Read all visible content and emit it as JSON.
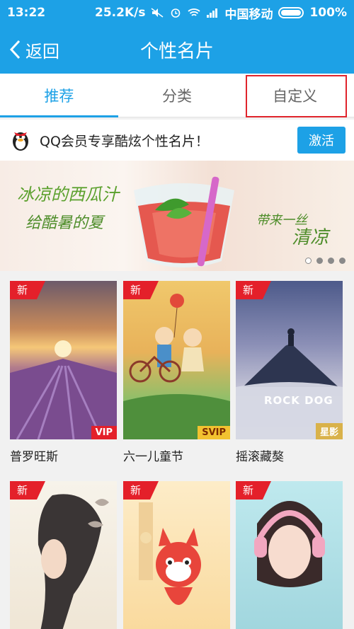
{
  "status": {
    "time": "13:22",
    "speed": "25.2K/s",
    "carrier": "中国移动",
    "battery": "100%"
  },
  "header": {
    "back_label": "返回",
    "title": "个性名片"
  },
  "tabs": [
    {
      "label": "推荐"
    },
    {
      "label": "分类"
    },
    {
      "label": "自定义"
    }
  ],
  "promo": {
    "text": "QQ会员专享酷炫个性名片！",
    "button": "激活"
  },
  "banner": {
    "line1": "冰凉的西瓜汁",
    "line2": "给酷暑的夏",
    "line3": "带来一丝",
    "line4": "清凉"
  },
  "cards": [
    {
      "badge": "新",
      "tag": "VIP",
      "name": "普罗旺斯"
    },
    {
      "badge": "新",
      "tag": "SVIP",
      "name": "六一儿童节"
    },
    {
      "badge": "新",
      "tag": "星影",
      "name": "摇滚藏獒",
      "image_text": "ROCK DOG"
    },
    {
      "badge": "新"
    },
    {
      "badge": "新"
    },
    {
      "badge": "新"
    }
  ]
}
